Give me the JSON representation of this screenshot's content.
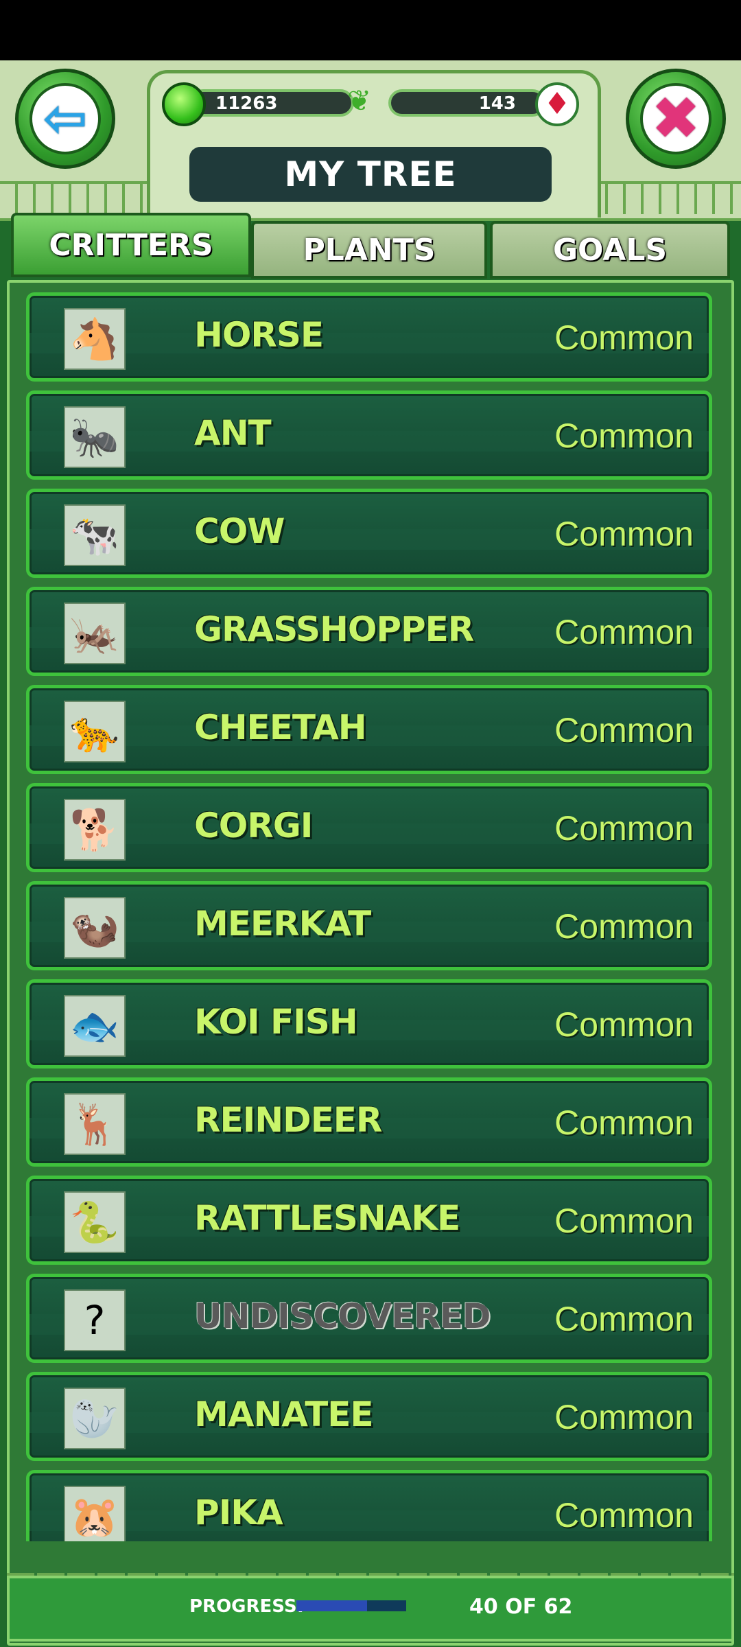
{
  "header": {
    "title": "MY TREE",
    "currency_left": "11263",
    "currency_right": "143",
    "back_icon": "back-arrow-icon",
    "close_icon": "close-x-icon"
  },
  "tabs": [
    {
      "label": "CRITTERS",
      "active": true
    },
    {
      "label": "PLANTS",
      "active": false
    },
    {
      "label": "GOALS",
      "active": false
    }
  ],
  "critters": [
    {
      "name": "HORSE",
      "rarity": "Common",
      "icon": "🐴"
    },
    {
      "name": "ANT",
      "rarity": "Common",
      "icon": "🐜"
    },
    {
      "name": "COW",
      "rarity": "Common",
      "icon": "🐄"
    },
    {
      "name": "GRASSHOPPER",
      "rarity": "Common",
      "icon": "🦗"
    },
    {
      "name": "CHEETAH",
      "rarity": "Common",
      "icon": "🐆"
    },
    {
      "name": "CORGI",
      "rarity": "Common",
      "icon": "🐕"
    },
    {
      "name": "MEERKAT",
      "rarity": "Common",
      "icon": "🦦"
    },
    {
      "name": "KOI FISH",
      "rarity": "Common",
      "icon": "🐟"
    },
    {
      "name": "REINDEER",
      "rarity": "Common",
      "icon": "🦌"
    },
    {
      "name": "RATTLESNAKE",
      "rarity": "Common",
      "icon": "🐍"
    },
    {
      "name": "UNDISCOVERED",
      "rarity": "Common",
      "icon": "?"
    },
    {
      "name": "MANATEE",
      "rarity": "Common",
      "icon": "🦭"
    },
    {
      "name": "PIKA",
      "rarity": "Common",
      "icon": "🐹"
    }
  ],
  "footer": {
    "progress_label": "PROGRESS:",
    "progress_count": "40 OF 62",
    "progress_fraction": 0.645
  },
  "colors": {
    "accent_green": "#3fc23c",
    "name_text": "#c8f56a",
    "row_bg": "#1c5f40",
    "progress_fill": "#2a4bb4"
  }
}
